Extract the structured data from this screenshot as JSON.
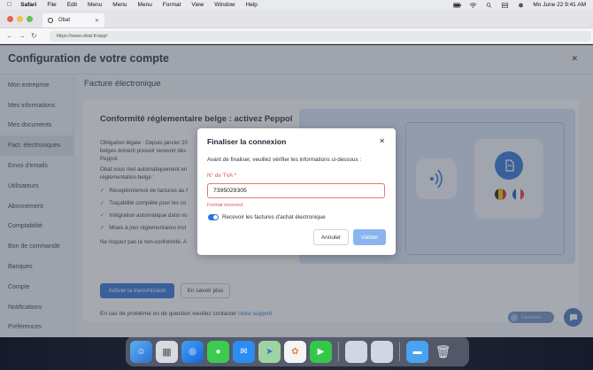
{
  "menubar": {
    "app": "Safari",
    "items": [
      "File",
      "Edit",
      "Menu",
      "Menu",
      "Menu",
      "Format",
      "View",
      "Window",
      "Help"
    ],
    "clock": "Mo June 22  9:41 AM"
  },
  "browser": {
    "tab_title": "Obat",
    "url": "https://www.obat.fr/app/"
  },
  "page": {
    "title": "Configuration de votre compte",
    "section_title": "Facture électronique",
    "sidebar": [
      {
        "label": "Mon entreprise"
      },
      {
        "label": "Mes informations"
      },
      {
        "label": "Mes documents"
      },
      {
        "label": "Fact. électroniques"
      },
      {
        "label": "Envoi d'emails"
      },
      {
        "label": "Utilisateurs"
      },
      {
        "label": "Abonnement"
      },
      {
        "label": "Comptabilité"
      },
      {
        "label": "Bon de commande"
      },
      {
        "label": "Banques"
      },
      {
        "label": "Compte"
      },
      {
        "label": "Notifications"
      },
      {
        "label": "Préférences"
      }
    ],
    "card": {
      "heading": "Conformité réglementaire belge : activez Peppol",
      "p1_line1": "Obligation légale : Depuis janvier 20",
      "p1_line2": "belges doivent pouvoir recevoir des",
      "p1_line3": "Peppol.",
      "p2_line1": "Obat vous met automatiquement en",
      "p2_line2": "réglementation belge :",
      "checks": [
        "Réception/envoi de factures au f",
        "Traçabilité complète pour les co",
        "Intégration automatique dans vo",
        "Mises à jour réglementaires incl"
      ],
      "note": "Ne risquez pas la non-conformité. A",
      "primary_button": "Activer la transmission",
      "secondary_button": "En savoir plus",
      "help_text": "En cas de problème ou de question veuillez contacter ",
      "help_link": "notre support"
    }
  },
  "modal": {
    "title": "Finaliser la connexion",
    "description": "Avant de finaliser, veuillez vérifier les informations ci-dessous :",
    "field_label": "N° de TVA *",
    "field_value": "7395029305",
    "field_error": "Format incorrect",
    "toggle_label": "Recevoir les factures d'achat électronique",
    "toggle_on": true,
    "cancel_label": "Annuler",
    "submit_label": "Valider"
  },
  "chat": {
    "pill_text": "Contactez"
  },
  "colors": {
    "primary": "#2f73d8",
    "error": "#d9534f",
    "submit_disabled": "#8ab4ee"
  }
}
